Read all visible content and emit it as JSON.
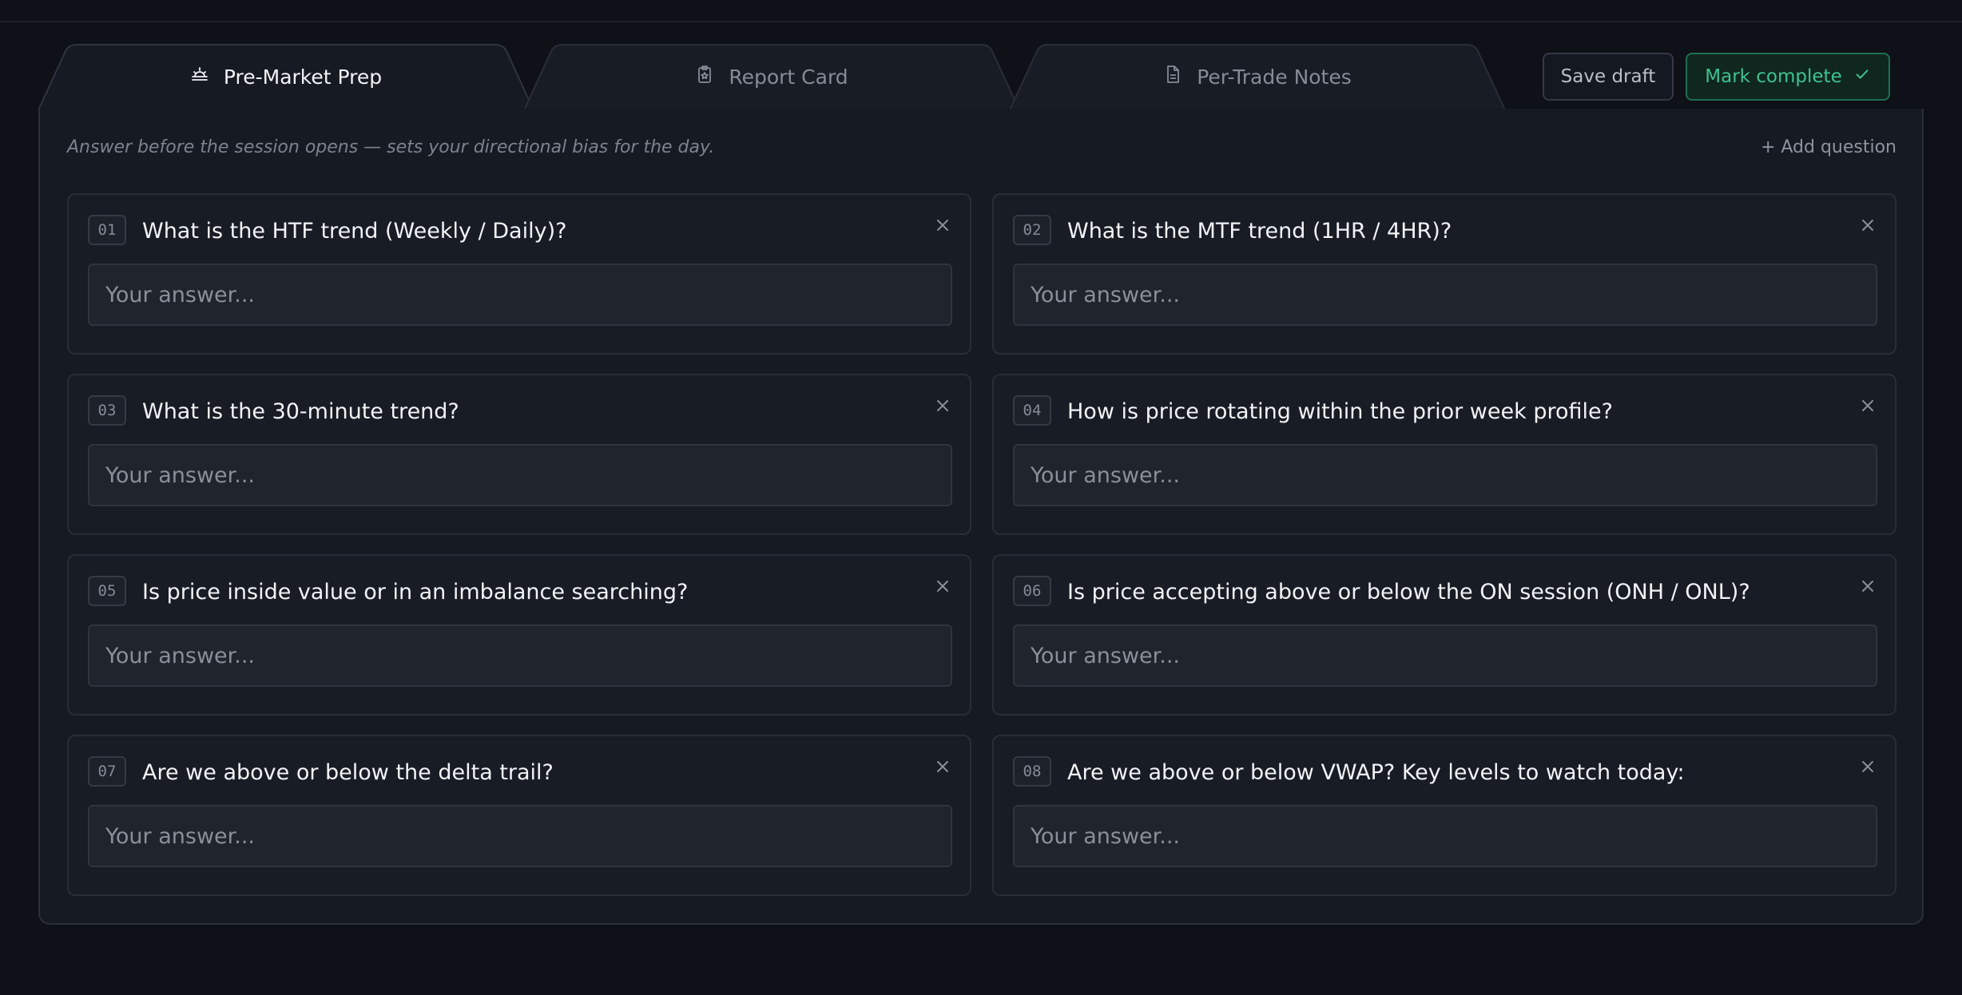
{
  "tabs": [
    {
      "label": "Pre-Market Prep",
      "icon": "sunrise-icon",
      "active": true
    },
    {
      "label": "Report Card",
      "icon": "clipboard-icon",
      "active": false
    },
    {
      "label": "Per-Trade Notes",
      "icon": "document-icon",
      "active": false
    }
  ],
  "actions": {
    "save_label": "Save draft",
    "complete_label": "Mark complete"
  },
  "panel": {
    "subtitle": "Answer before the session opens — sets your directional bias for the day.",
    "add_question_label": "+ Add question"
  },
  "answer_placeholder": "Your answer...",
  "questions": [
    {
      "num": "01",
      "text": "What is the HTF trend (Weekly / Daily)?"
    },
    {
      "num": "02",
      "text": "What is the MTF trend (1HR / 4HR)?"
    },
    {
      "num": "03",
      "text": "What is the 30-minute trend?"
    },
    {
      "num": "04",
      "text": "How is price rotating within the prior week profile?"
    },
    {
      "num": "05",
      "text": "Is price inside value or in an imbalance searching?"
    },
    {
      "num": "06",
      "text": "Is price accepting above or below the ON session (ONH / ONL)?"
    },
    {
      "num": "07",
      "text": "Are we above or below the delta trail?"
    },
    {
      "num": "08",
      "text": "Are we above or below VWAP? Key levels to watch today:"
    }
  ],
  "colors": {
    "background": "#0e1118",
    "panel": "#161a22",
    "accent_green": "#3ec28e"
  }
}
